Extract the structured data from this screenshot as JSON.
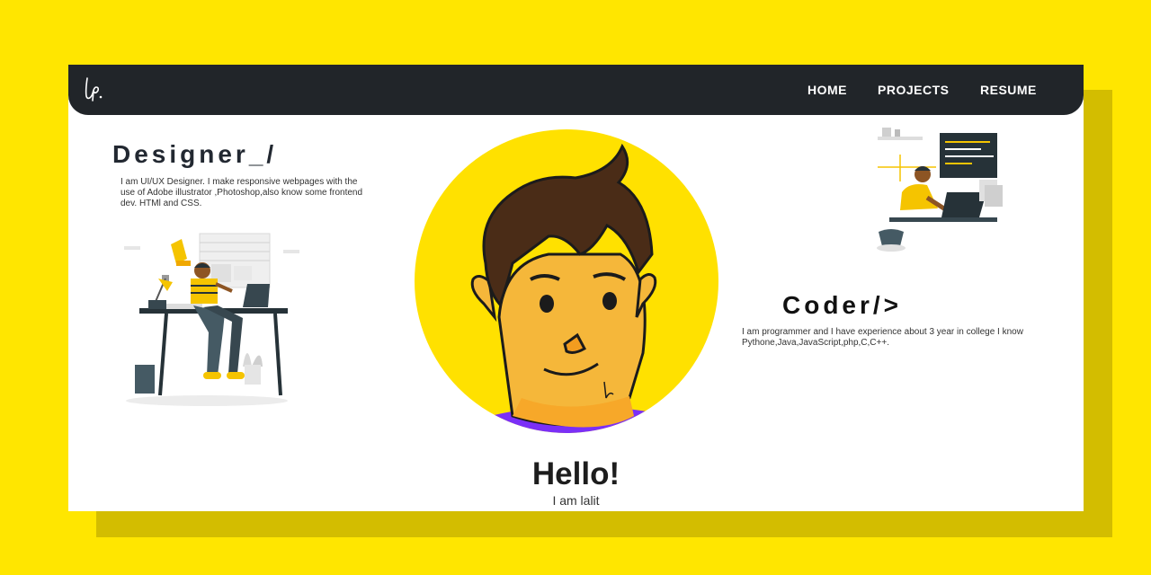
{
  "nav": {
    "logo_text": "lp.",
    "items": [
      {
        "label": "HOME"
      },
      {
        "label": "PROJECTS"
      },
      {
        "label": "RESUME"
      }
    ]
  },
  "designer": {
    "heading": "Designer_/",
    "description": "I am UI/UX Designer. I make responsive webpages with the use of Adobe illustrator ,Photoshop,also know some frontend dev. HTMl and CSS."
  },
  "coder": {
    "heading": "Coder/>",
    "description": "I am programmer and I have experience about 3 year in college I know Pythone,Java,JavaScript,php,C,C++."
  },
  "hero": {
    "title": "Hello!",
    "subtitle": "I am lalit",
    "signature": "lp."
  },
  "colors": {
    "page_background": "#ffe600",
    "navbar": "#212529",
    "avatar_circle": "#ffe100"
  }
}
